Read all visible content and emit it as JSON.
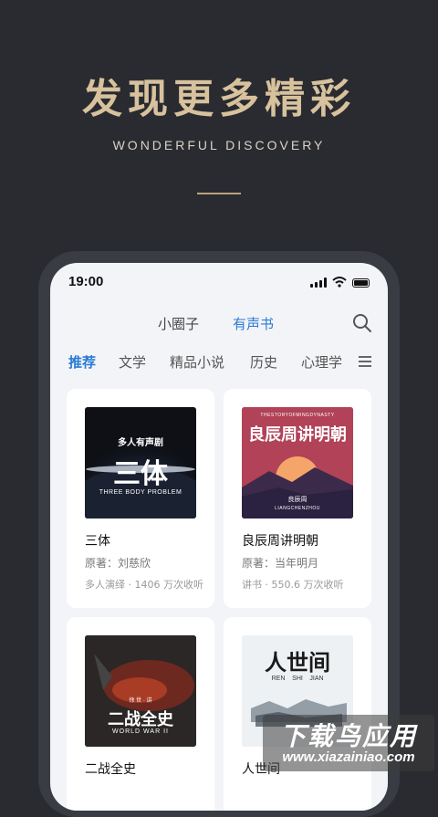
{
  "hero": {
    "title": "发现更多精彩",
    "subtitle": "WONDERFUL DISCOVERY"
  },
  "status": {
    "time": "19:00"
  },
  "top_tabs": [
    "小圈子",
    "有声书"
  ],
  "categories": [
    "推荐",
    "文学",
    "精品小说",
    "历史",
    "心理学"
  ],
  "cards": [
    {
      "title": "三体",
      "author": "原著：刘慈欣",
      "meta": "多人演绎 · 1406 万次收听",
      "cover": {
        "tag": "多人有声剧",
        "main": "三体",
        "sub": "THREE BODY PROBLEM"
      }
    },
    {
      "title": "良辰周讲明朝",
      "author": "原著：当年明月",
      "meta": "讲书 · 550.6 万次收听",
      "cover": {
        "top": "THESTORYOFMINGDYNASTY",
        "main": "良辰周讲明朝",
        "sig": "良辰周",
        "bottom": "LIANGCHENZHOU"
      }
    },
    {
      "title": "二战全史",
      "cover": {
        "small": "徐 世 · 讲",
        "main": "二战全史",
        "sub": "WORLD WAR II"
      }
    },
    {
      "title": "人世间",
      "cover": {
        "main": "人世间",
        "sub1": "REN",
        "sub2": "SHI",
        "sub3": "JIAN"
      }
    }
  ],
  "watermark": {
    "title": "下载鸟应用",
    "url": "www.xiazainiao.com"
  },
  "colors": {
    "accent": "#2a7bd6",
    "gold": "#d8c29d",
    "background": "#2a2b31"
  }
}
